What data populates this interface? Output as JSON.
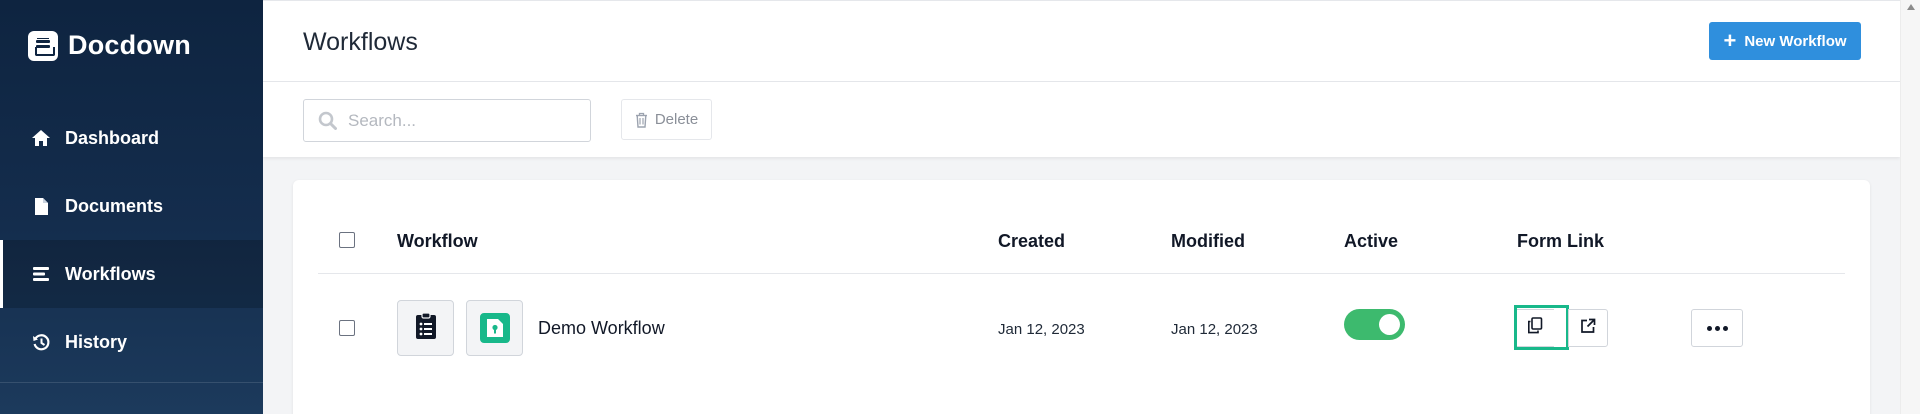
{
  "app": {
    "name": "Docdown",
    "logo_icon": "archive-box-icon"
  },
  "sidebar": {
    "items": [
      {
        "label": "Dashboard",
        "icon": "home-icon",
        "active": false
      },
      {
        "label": "Documents",
        "icon": "file-icon",
        "active": false
      },
      {
        "label": "Workflows",
        "icon": "list-icon",
        "active": true
      },
      {
        "label": "History",
        "icon": "history-icon",
        "active": false
      }
    ]
  },
  "header": {
    "title": "Workflows",
    "new_button_label": "New Workflow",
    "new_button_color": "#2f8fdd"
  },
  "toolbar": {
    "search_placeholder": "Search...",
    "search_value": "",
    "delete_label": "Delete"
  },
  "table": {
    "columns": [
      "Workflow",
      "Created",
      "Modified",
      "Active",
      "Form Link"
    ],
    "rows": [
      {
        "name": "Demo Workflow",
        "created": "Jan 12, 2023",
        "modified": "Jan 12, 2023",
        "active": true,
        "checked": false,
        "icons": [
          "clipboard-list-icon",
          "lock-file-icon"
        ]
      }
    ]
  },
  "colors": {
    "sidebar_bg": "#0e2440",
    "accent_green": "#18b88a",
    "toggle_on": "#3dba6e"
  }
}
